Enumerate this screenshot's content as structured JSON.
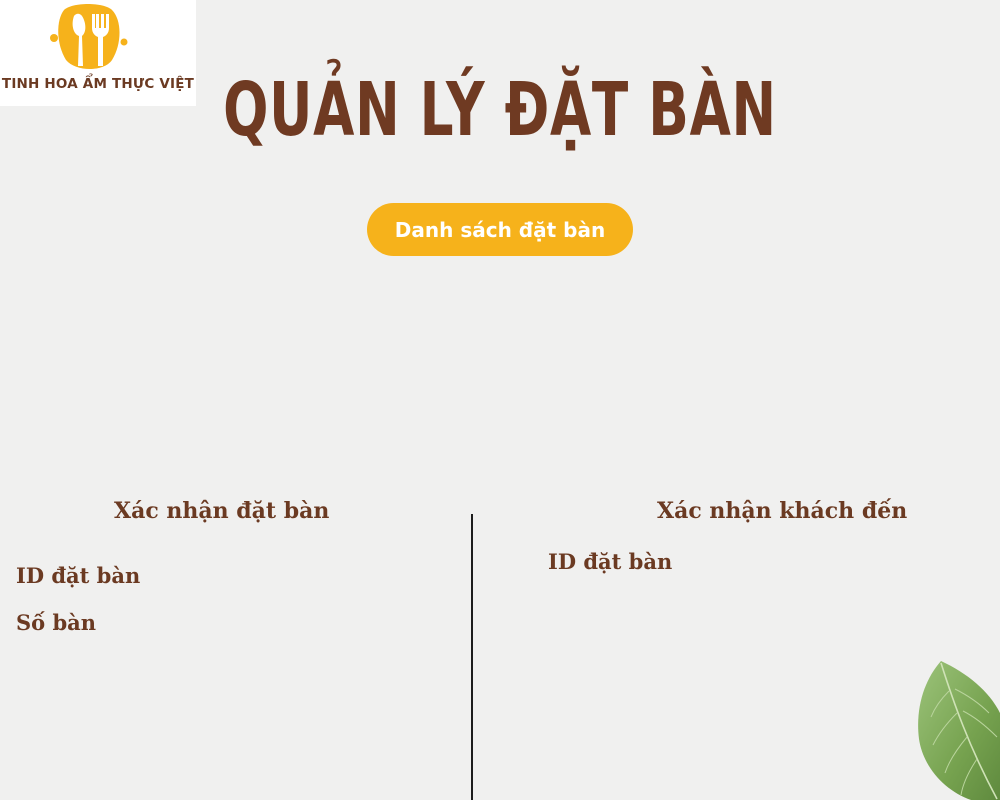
{
  "brand": {
    "logo_text": "TINH HOA ẨM THỰC VIỆT",
    "logo_icon": "fork-knife-icon",
    "icon_color": "#f6b21b"
  },
  "header": {
    "title": "QUẢN LÝ ĐẶT BÀN"
  },
  "actions": {
    "booking_list_label": "Danh sách đặt bàn"
  },
  "confirm_booking": {
    "title": "Xác nhận đặt bàn",
    "booking_id_label": "ID đặt bàn",
    "table_number_label": "Số bàn"
  },
  "confirm_arrival": {
    "title": "Xác nhận khách đến",
    "booking_id_label": "ID đặt bàn"
  },
  "colors": {
    "background": "#f0f0ef",
    "accent": "#f6b21b",
    "brown": "#6b3a22",
    "leaf": "#7fa95a"
  }
}
